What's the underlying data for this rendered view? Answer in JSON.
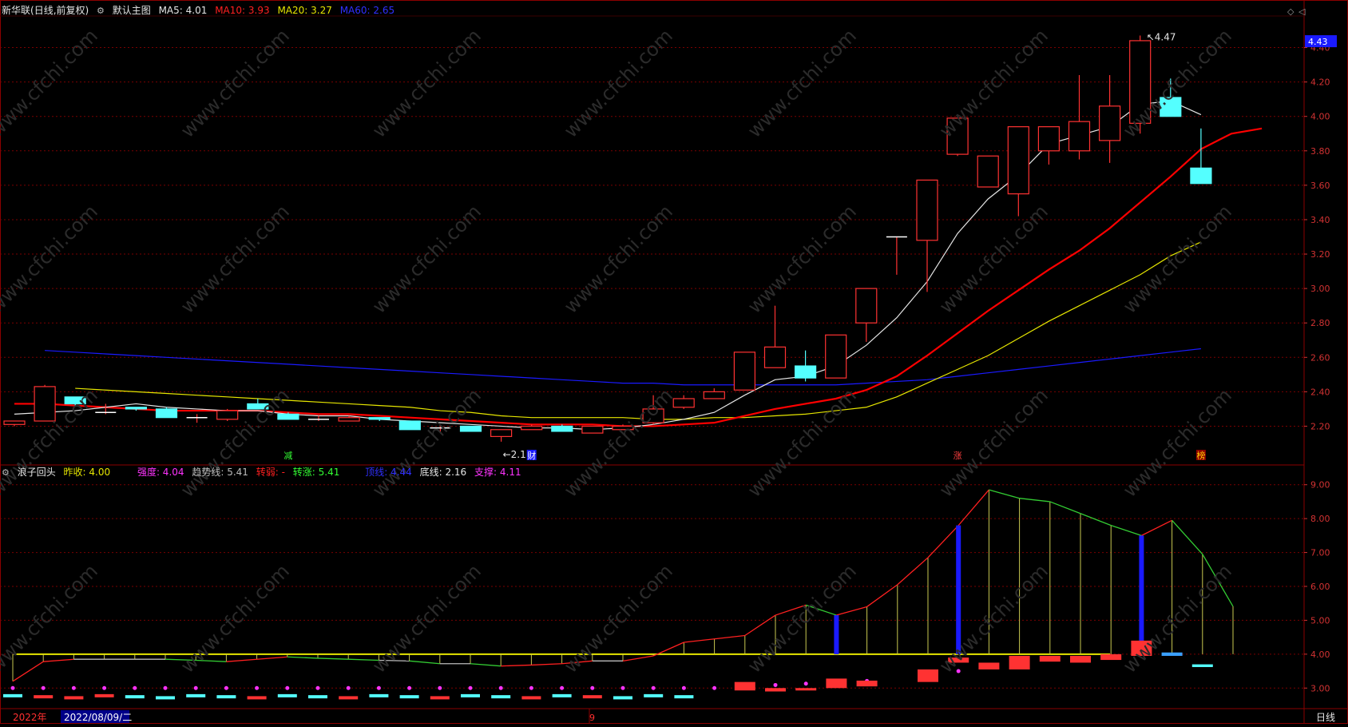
{
  "main_header": {
    "stock_name": "新华联",
    "mode": "(日线,前复权)",
    "template": "默认主图",
    "ma5": "MA5: 4.01",
    "ma10": "MA10: 3.93",
    "ma20": "MA20: 3.27",
    "ma60": "MA60: 2.65"
  },
  "sub_header": {
    "name": "浪子回头",
    "prev_close": "昨收: 4.00",
    "strength": "强度: 4.04",
    "trend": "趋势线: 5.41",
    "turn_weak": "转弱: -",
    "turn_up": "转涨: 5.41",
    "top_line": "顶线: 4.44",
    "bottom_line": "底线: 2.16",
    "support": "支撑: 4.11"
  },
  "colors": {
    "up": "#ff3232",
    "down": "#54ffff",
    "ma5": "#e6e6e6",
    "ma10": "#ff0000",
    "ma20": "#e6e600",
    "ma60": "#1a1aff",
    "grid": "#7a0000",
    "axis_text": "#d23232",
    "magenta": "#ff33ff"
  },
  "price_axis": {
    "ticks": [
      "4.40",
      "4.20",
      "4.00",
      "3.80",
      "3.60",
      "3.40",
      "3.20",
      "3.00",
      "2.80",
      "2.60",
      "2.40",
      "2.20"
    ],
    "current": "4.43"
  },
  "sub_axis": {
    "ticks": [
      "9.00",
      "8.00",
      "7.00",
      "6.00",
      "5.00",
      "4.00",
      "3.00"
    ]
  },
  "annotations": {
    "high": "4.47",
    "low": "2.11",
    "marker_1": "减",
    "marker_2": "财",
    "marker_3": "涨",
    "marker_4": "榜"
  },
  "bottom_bar": {
    "year": "2022年",
    "date": "2022/08/09/二",
    "mid": "9",
    "period_button": "日线"
  },
  "watermark": "www.cfchi.com",
  "chart_data": {
    "type": "candlestick",
    "price_ylim": [
      2.1,
      4.5
    ],
    "candles": [
      {
        "o": 2.21,
        "c": 2.23,
        "h": 2.23,
        "l": 2.2
      },
      {
        "o": 2.23,
        "c": 2.43,
        "h": 2.44,
        "l": 2.23
      },
      {
        "o": 2.37,
        "c": 2.33,
        "h": 2.37,
        "l": 2.32
      },
      {
        "o": 2.28,
        "c": 2.28,
        "h": 2.33,
        "l": 2.27
      },
      {
        "o": 2.31,
        "c": 2.3,
        "h": 2.31,
        "l": 2.29
      },
      {
        "o": 2.3,
        "c": 2.25,
        "h": 2.31,
        "l": 2.25
      },
      {
        "o": 2.25,
        "c": 2.25,
        "h": 2.27,
        "l": 2.22
      },
      {
        "o": 2.24,
        "c": 2.29,
        "h": 2.3,
        "l": 2.23
      },
      {
        "o": 2.33,
        "c": 2.3,
        "h": 2.36,
        "l": 2.3
      },
      {
        "o": 2.27,
        "c": 2.24,
        "h": 2.28,
        "l": 2.24
      },
      {
        "o": 2.24,
        "c": 2.24,
        "h": 2.26,
        "l": 2.23
      },
      {
        "o": 2.23,
        "c": 2.25,
        "h": 2.26,
        "l": 2.23
      },
      {
        "o": 2.25,
        "c": 2.24,
        "h": 2.25,
        "l": 2.23
      },
      {
        "o": 2.23,
        "c": 2.18,
        "h": 2.23,
        "l": 2.18
      },
      {
        "o": 2.19,
        "c": 2.19,
        "h": 2.2,
        "l": 2.16
      },
      {
        "o": 2.2,
        "c": 2.17,
        "h": 2.2,
        "l": 2.17
      },
      {
        "o": 2.14,
        "c": 2.18,
        "h": 2.18,
        "l": 2.11
      },
      {
        "o": 2.18,
        "c": 2.2,
        "h": 2.21,
        "l": 2.18
      },
      {
        "o": 2.2,
        "c": 2.17,
        "h": 2.21,
        "l": 2.17
      },
      {
        "o": 2.16,
        "c": 2.2,
        "h": 2.2,
        "l": 2.16
      },
      {
        "o": 2.18,
        "c": 2.2,
        "h": 2.21,
        "l": 2.18
      },
      {
        "o": 2.22,
        "c": 2.3,
        "h": 2.38,
        "l": 2.21
      },
      {
        "o": 2.31,
        "c": 2.36,
        "h": 2.38,
        "l": 2.3
      },
      {
        "o": 2.36,
        "c": 2.4,
        "h": 2.42,
        "l": 2.36
      },
      {
        "o": 2.41,
        "c": 2.63,
        "h": 2.63,
        "l": 2.41
      },
      {
        "o": 2.54,
        "c": 2.66,
        "h": 2.9,
        "l": 2.54
      },
      {
        "o": 2.55,
        "c": 2.48,
        "h": 2.64,
        "l": 2.46
      },
      {
        "o": 2.48,
        "c": 2.73,
        "h": 2.73,
        "l": 2.48
      },
      {
        "o": 2.8,
        "c": 3.0,
        "h": 3.0,
        "l": 2.69
      },
      {
        "o": 3.3,
        "c": 3.3,
        "h": 3.3,
        "l": 3.08
      },
      {
        "o": 3.28,
        "c": 3.63,
        "h": 3.63,
        "l": 2.98
      },
      {
        "o": 3.78,
        "c": 3.99,
        "h": 3.99,
        "l": 3.77
      },
      {
        "o": 3.59,
        "c": 3.77,
        "h": 3.77,
        "l": 3.59
      },
      {
        "o": 3.55,
        "c": 3.94,
        "h": 3.94,
        "l": 3.42
      },
      {
        "o": 3.8,
        "c": 3.94,
        "h": 3.94,
        "l": 3.72
      },
      {
        "o": 3.8,
        "c": 3.97,
        "h": 4.24,
        "l": 3.75
      },
      {
        "o": 3.86,
        "c": 4.06,
        "h": 4.24,
        "l": 3.73
      },
      {
        "o": 3.96,
        "c": 4.44,
        "h": 4.47,
        "l": 3.9
      },
      {
        "o": 4.11,
        "c": 4.0,
        "h": 4.22,
        "l": 4.0
      },
      {
        "o": 3.7,
        "c": 3.61,
        "h": 3.93,
        "l": 3.61
      }
    ],
    "ma5": [
      2.27,
      2.28,
      2.29,
      2.31,
      2.33,
      2.31,
      2.3,
      2.29,
      2.29,
      2.27,
      2.26,
      2.26,
      2.24,
      2.23,
      2.22,
      2.21,
      2.2,
      2.19,
      2.19,
      2.18,
      2.19,
      2.21,
      2.24,
      2.28,
      2.38,
      2.47,
      2.49,
      2.55,
      2.67,
      2.83,
      3.04,
      3.32,
      3.52,
      3.66,
      3.84,
      3.89,
      3.94,
      4.07,
      4.09,
      4.01
    ],
    "ma10": [
      2.33,
      2.33,
      2.32,
      2.31,
      2.3,
      2.29,
      2.29,
      2.29,
      2.29,
      2.28,
      2.27,
      2.27,
      2.26,
      2.25,
      2.24,
      2.23,
      2.22,
      2.21,
      2.21,
      2.21,
      2.2,
      2.2,
      2.21,
      2.22,
      2.26,
      2.3,
      2.33,
      2.36,
      2.41,
      2.49,
      2.61,
      2.74,
      2.87,
      2.99,
      3.11,
      3.22,
      3.35,
      3.5,
      3.65,
      3.81,
      3.9,
      3.93
    ],
    "ma20": [
      2.42,
      2.41,
      2.4,
      2.39,
      2.38,
      2.37,
      2.36,
      2.35,
      2.34,
      2.33,
      2.32,
      2.31,
      2.29,
      2.28,
      2.26,
      2.25,
      2.25,
      2.25,
      2.25,
      2.24,
      2.24,
      2.25,
      2.25,
      2.26,
      2.27,
      2.29,
      2.31,
      2.37,
      2.45,
      2.53,
      2.61,
      2.71,
      2.81,
      2.9,
      2.99,
      3.08,
      3.19,
      3.27
    ],
    "ma60": [
      2.64,
      2.63,
      2.62,
      2.61,
      2.6,
      2.59,
      2.58,
      2.57,
      2.56,
      2.55,
      2.54,
      2.53,
      2.52,
      2.51,
      2.5,
      2.49,
      2.48,
      2.47,
      2.46,
      2.45,
      2.45,
      2.44,
      2.44,
      2.44,
      2.44,
      2.44,
      2.44,
      2.45,
      2.46,
      2.47,
      2.49,
      2.51,
      2.53,
      2.55,
      2.57,
      2.59,
      2.61,
      2.63,
      2.65
    ],
    "sub_ylim": [
      2.7,
      9.3
    ],
    "sub_baseline": 4.0,
    "trend": [
      3.2,
      3.78,
      3.85,
      3.85,
      3.85,
      3.85,
      3.82,
      3.78,
      3.85,
      3.92,
      3.88,
      3.85,
      3.82,
      3.8,
      3.72,
      3.72,
      3.65,
      3.68,
      3.72,
      3.8,
      3.8,
      3.95,
      4.35,
      4.45,
      4.55,
      5.15,
      5.45,
      5.15,
      5.4,
      6.05,
      6.85,
      7.8,
      8.85,
      8.6,
      8.5,
      8.15,
      7.8,
      7.5,
      7.95,
      6.95,
      5.41
    ],
    "blue_bars": [
      27,
      31,
      37
    ],
    "sub_candles": [
      {
        "i": 24,
        "o": 3.18,
        "c": 2.93
      },
      {
        "i": 25,
        "o": 3.0,
        "c": 2.9
      },
      {
        "i": 26,
        "o": 3.0,
        "c": 2.93
      },
      {
        "i": 27,
        "o": 3.28,
        "c": 3.0
      },
      {
        "i": 28,
        "o": 3.22,
        "c": 3.05
      },
      {
        "i": 30,
        "o": 3.55,
        "c": 3.18
      },
      {
        "i": 31,
        "o": 3.9,
        "c": 3.75
      },
      {
        "i": 32,
        "o": 3.75,
        "c": 3.55
      },
      {
        "i": 33,
        "o": 3.95,
        "c": 3.55
      },
      {
        "i": 34,
        "o": 3.95,
        "c": 3.78
      },
      {
        "i": 35,
        "o": 3.95,
        "c": 3.75
      },
      {
        "i": 36,
        "o": 4.0,
        "c": 3.83
      },
      {
        "i": 37,
        "o": 4.4,
        "c": 3.95
      },
      {
        "i": 38,
        "o": 4.05,
        "c": 3.95
      },
      {
        "i": 39,
        "o": 3.7,
        "c": 3.62
      }
    ]
  }
}
